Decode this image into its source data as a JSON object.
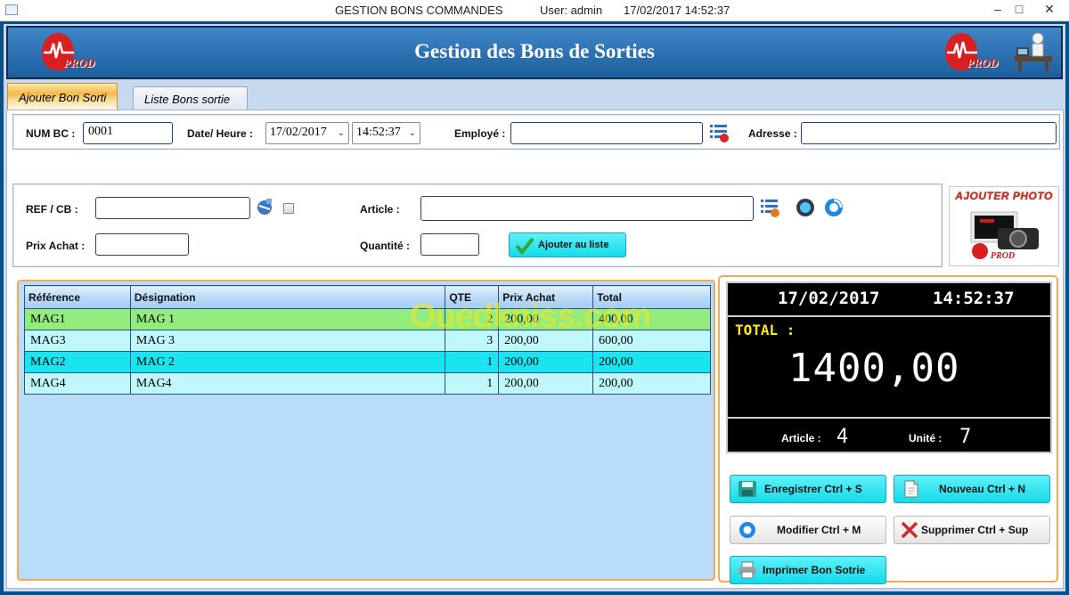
{
  "window": {
    "title": "GESTION BONS COMMANDES",
    "user": "User: admin",
    "datetime": "17/02/2017 14:52:37",
    "controls": {
      "minimize": "–",
      "maximize": "□",
      "close": "✕"
    }
  },
  "banner": {
    "title": "Gestion des Bons de Sorties",
    "logo_text": "PROD"
  },
  "tabs": [
    {
      "label": "Ajouter Bon Sorti",
      "active": true
    },
    {
      "label": "Liste Bons sortie",
      "active": false
    }
  ],
  "form": {
    "num_bc_label": "NUM BC :",
    "num_bc_value": "0001",
    "date_label": "Date/ Heure :",
    "date_value": "17/02/2017",
    "time_value": "14:52:37",
    "employe_label": "Employé :",
    "employe_value": "",
    "adresse_label": "Adresse :",
    "adresse_value": "",
    "ref_label": "REF  / CB :",
    "ref_value": "",
    "article_label": "Article :",
    "article_value": "",
    "prix_label": "Prix Achat :",
    "prix_value": "",
    "quantite_label": "Quantité :",
    "quantite_value": "",
    "add_button": "Ajouter au liste",
    "photo_title": "AJOUTER PHOTO"
  },
  "grid": {
    "columns": [
      "Référence",
      "Désignation",
      "QTE",
      "Prix Achat",
      "Total"
    ],
    "rows": [
      {
        "ref": "MAG1",
        "designation": "MAG 1",
        "qte": "2",
        "prix": "200,00",
        "total": "400,00",
        "style": "sel"
      },
      {
        "ref": "MAG3",
        "designation": "MAG 3",
        "qte": "3",
        "prix": "200,00",
        "total": "600,00",
        "style": "a"
      },
      {
        "ref": "MAG2",
        "designation": "MAG 2",
        "qte": "1",
        "prix": "200,00",
        "total": "200,00",
        "style": "b"
      },
      {
        "ref": "MAG4",
        "designation": "MAG4",
        "qte": "1",
        "prix": "200,00",
        "total": "200,00",
        "style": "a"
      }
    ]
  },
  "watermark": "Ouedkniss.com",
  "summary": {
    "date": "17/02/2017",
    "time": "14:52:37",
    "total_label": "TOTAL :",
    "total_value": "1400,00",
    "article_label": "Article :",
    "article_value": "4",
    "unite_label": "Unité :",
    "unite_value": "7"
  },
  "actions": {
    "save": "Enregistrer  Ctrl + S",
    "new": "Nouveau  Ctrl + N",
    "edit": "Modifier  Ctrl + M",
    "delete": "Supprimer  Ctrl + Sup",
    "print": "Imprimer Bon Sotrie"
  },
  "colors": {
    "accent_cyan": "#14dbe8",
    "row_selected": "#93ec7e",
    "row_alt": "#bff8fb",
    "frame_blue": "#0a4f86",
    "orange_border": "#f3a95c"
  }
}
